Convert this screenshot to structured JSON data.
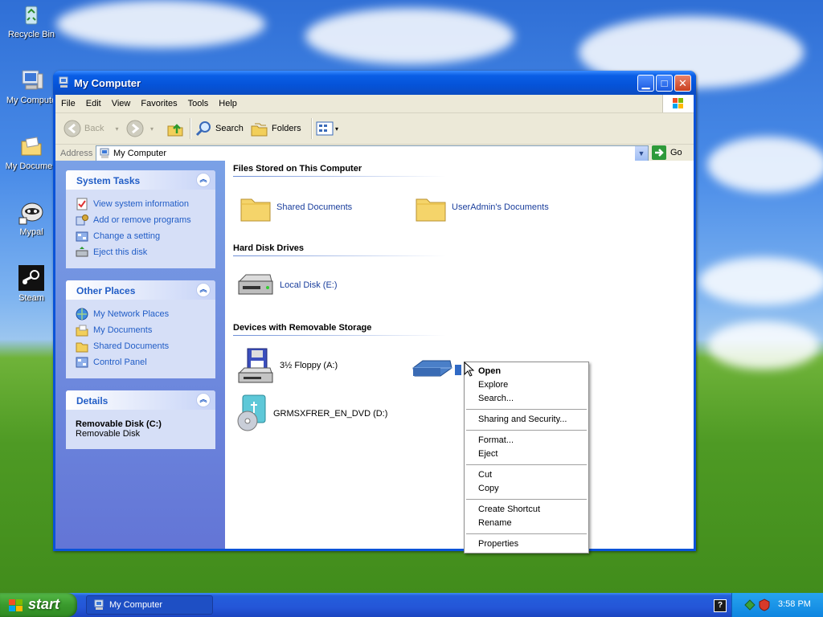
{
  "desktop": {
    "icons": [
      {
        "label": "Recycle Bin"
      },
      {
        "label": "My Compute"
      },
      {
        "label": "My Documen"
      },
      {
        "label": "Mypal"
      },
      {
        "label": "Steam"
      }
    ]
  },
  "window": {
    "title": "My Computer",
    "menu": [
      "File",
      "Edit",
      "View",
      "Favorites",
      "Tools",
      "Help"
    ],
    "toolbar": {
      "back": "Back",
      "search": "Search",
      "folders": "Folders"
    },
    "address": {
      "label": "Address",
      "value": "My Computer",
      "go": "Go"
    }
  },
  "leftpane": {
    "system_tasks": {
      "title": "System Tasks",
      "items": [
        "View system information",
        "Add or remove programs",
        "Change a setting",
        "Eject this disk"
      ]
    },
    "other_places": {
      "title": "Other Places",
      "items": [
        "My Network Places",
        "My Documents",
        "Shared Documents",
        "Control Panel"
      ]
    },
    "details": {
      "title": "Details",
      "name": "Removable Disk (C:)",
      "type": "Removable Disk"
    }
  },
  "rightpane": {
    "groups": [
      {
        "title": "Files Stored on This Computer",
        "items": [
          "Shared Documents",
          "UserAdmin's Documents"
        ]
      },
      {
        "title": "Hard Disk Drives",
        "items": [
          "Local Disk (E:)"
        ]
      },
      {
        "title": "Devices with Removable Storage",
        "items": [
          "3½ Floppy (A:)",
          "GRMSXFRER_EN_DVD (D:)"
        ]
      }
    ]
  },
  "context_menu": {
    "items": [
      "Open",
      "Explore",
      "Search...",
      "Sharing and Security...",
      "Format...",
      "Eject",
      "Cut",
      "Copy",
      "Create Shortcut",
      "Rename",
      "Properties"
    ]
  },
  "taskbar": {
    "start": "start",
    "task": "My Computer",
    "clock": "3:58 PM",
    "help": "?"
  }
}
